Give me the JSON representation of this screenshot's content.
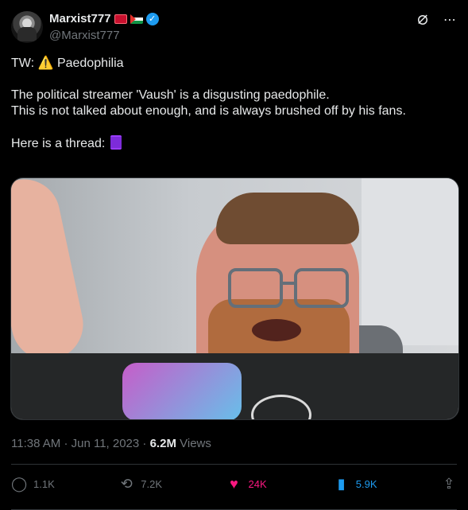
{
  "user": {
    "display_name": "Marxist777",
    "handle": "@Marxist777"
  },
  "post": {
    "line1_prefix": "TW:",
    "line1_warning": "⚠️",
    "line1_text": "Paedophilia",
    "line2": "The political streamer 'Vaush' is a disgusting paedophile.",
    "line3": "This is not talked about enough, and is always brushed off by his fans.",
    "line4_text": "Here is a thread:",
    "line4_icon": "🧵"
  },
  "meta": {
    "time": "11:38 AM",
    "separator1": "·",
    "date": "Jun 11, 2023",
    "separator2": "·",
    "views_value": "6.2M",
    "views_label": "Views"
  },
  "actions": {
    "reply_count": "1.1K",
    "repost_count": "7.2K",
    "like_count": "24K",
    "bookmark_count": "5.9K"
  },
  "icons": {
    "verified": "verified-icon",
    "grok": "grok-icon",
    "more": "more-icon",
    "reply": "reply-icon",
    "repost": "repost-icon",
    "like": "heart-icon",
    "bookmark": "bookmark-icon",
    "share": "share-icon"
  },
  "colors": {
    "background": "#000000",
    "text": "#e7e9ea",
    "muted": "#71767b",
    "like": "#f91880",
    "bookmark": "#1d9bf0",
    "verified": "#1d9bf0"
  }
}
